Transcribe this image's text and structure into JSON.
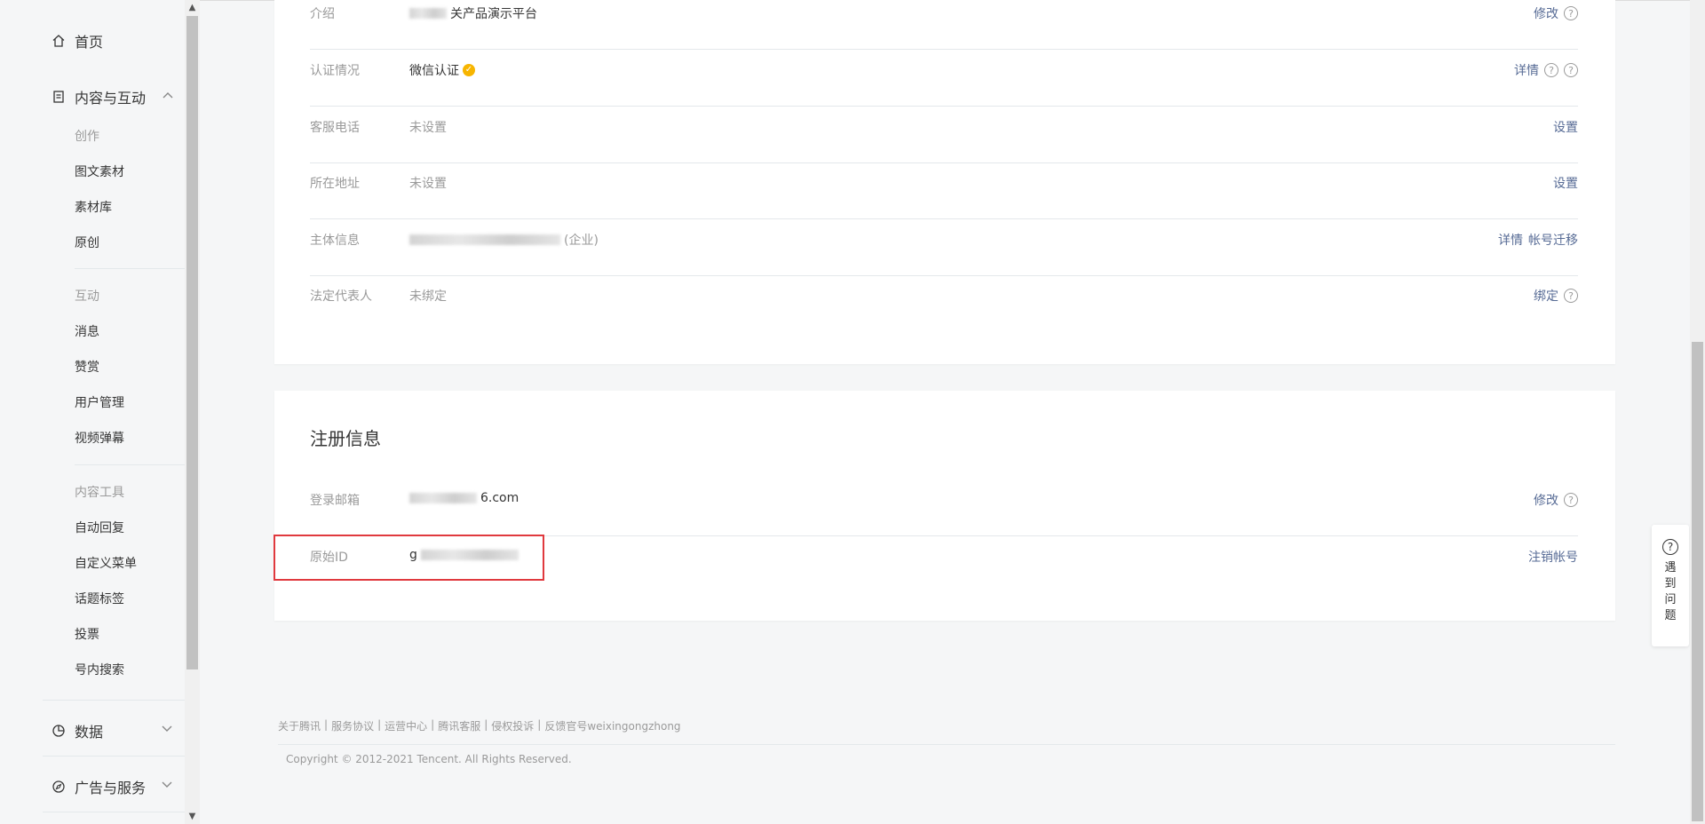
{
  "sidebar": {
    "home": "首页",
    "content": "内容与互动",
    "groups": {
      "create": "创作",
      "interact": "互动",
      "tools": "内容工具"
    },
    "items": {
      "article": "图文素材",
      "library": "素材库",
      "original": "原创",
      "message": "消息",
      "reward": "赞赏",
      "users": "用户管理",
      "danmaku": "视频弹幕",
      "autoreply": "自动回复",
      "menu": "自定义菜单",
      "topic": "话题标签",
      "vote": "投票",
      "search": "号内搜索"
    },
    "data": "数据",
    "ads": "广告与服务"
  },
  "account": {
    "intro": {
      "label": "介绍",
      "value": "关产品演示平台",
      "action": "修改"
    },
    "verify": {
      "label": "认证情况",
      "value": "微信认证",
      "action": "详情"
    },
    "phone": {
      "label": "客服电话",
      "value": "未设置",
      "action": "设置"
    },
    "address": {
      "label": "所在地址",
      "value": "未设置",
      "action": "设置"
    },
    "subject": {
      "label": "主体信息",
      "value": "(企业)",
      "action1": "详情",
      "action2": "帐号迁移"
    },
    "legal": {
      "label": "法定代表人",
      "value": "未绑定",
      "action": "绑定"
    }
  },
  "register": {
    "title": "注册信息",
    "email": {
      "label": "登录邮箱",
      "value": "6.com",
      "action": "修改"
    },
    "origid": {
      "label": "原始ID",
      "value": "g",
      "action": "注销帐号"
    }
  },
  "footer": {
    "links": [
      "关于腾讯",
      "服务协议",
      "运营中心",
      "腾讯客服",
      "侵权投诉",
      "反馈官号weixingongzhong"
    ],
    "copyright": "Copyright © 2012-2021 Tencent. All Rights Reserved."
  },
  "help": {
    "label": "遇到问题"
  },
  "colors": {
    "link": "#576b95",
    "highlight": "#e0393e",
    "verified": "#f7b500"
  }
}
